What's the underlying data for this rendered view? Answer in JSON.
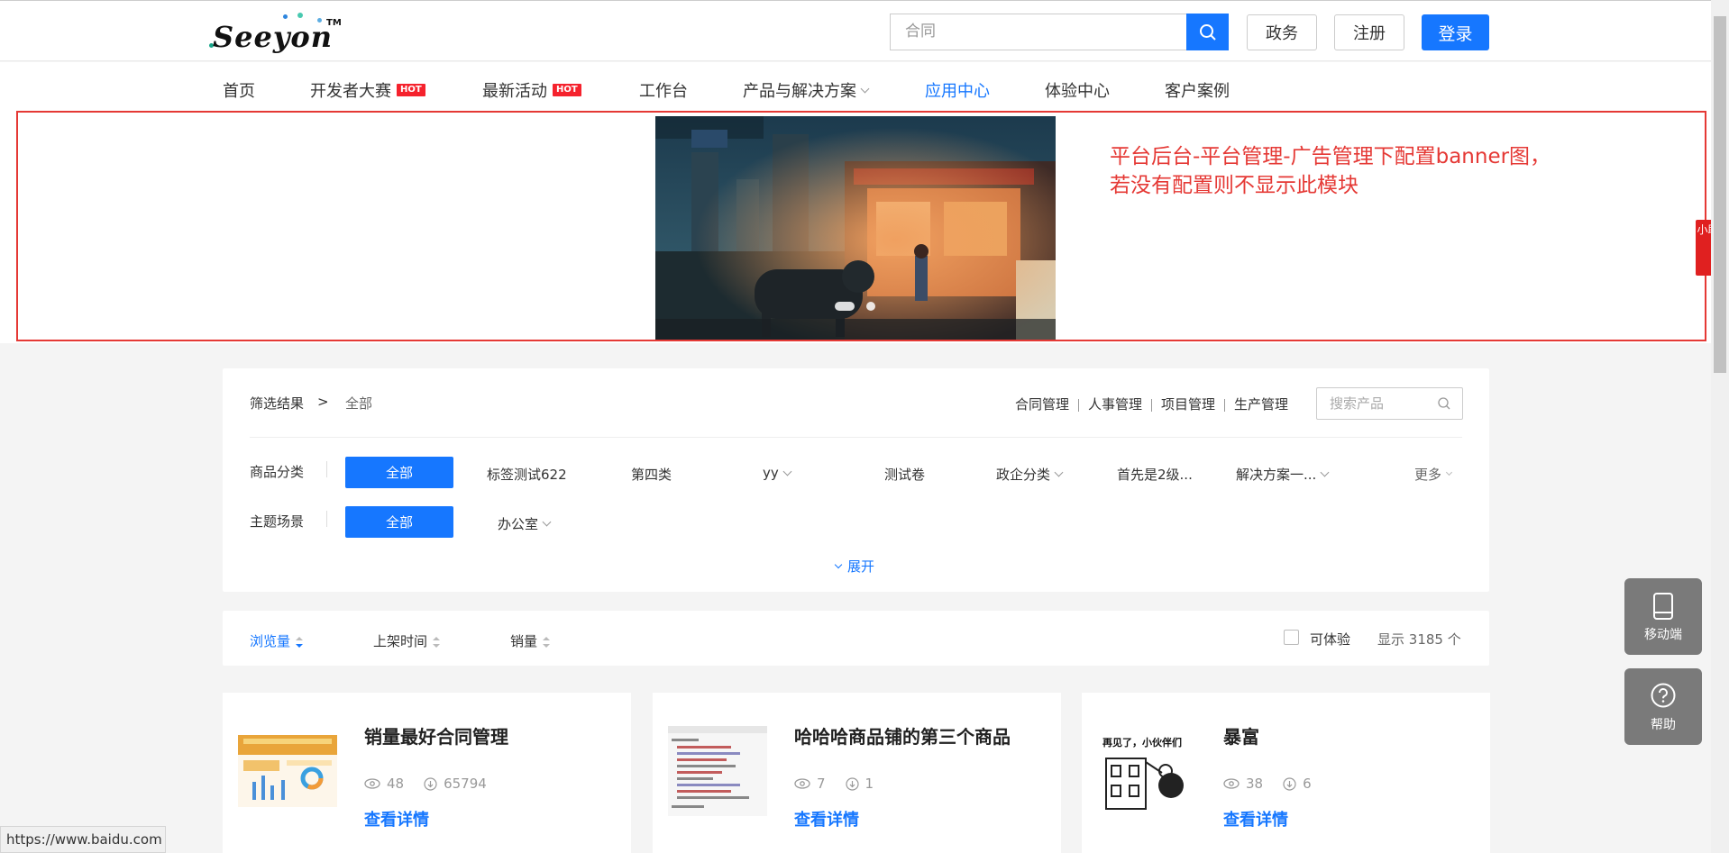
{
  "header": {
    "logo_text": "Seeyon",
    "logo_tm": "TM",
    "search_value": "合同",
    "gov_label": "政务",
    "register_label": "注册",
    "login_label": "登录"
  },
  "nav": {
    "items": [
      {
        "label": "首页"
      },
      {
        "label": "开发者大赛",
        "badge": "HOT"
      },
      {
        "label": "最新活动",
        "badge": "HOT"
      },
      {
        "label": "工作台"
      },
      {
        "label": "产品与解决方案"
      },
      {
        "label": "应用中心",
        "active": true
      },
      {
        "label": "体验中心"
      },
      {
        "label": "客户案例"
      }
    ]
  },
  "banner": {
    "note_line1": "平台后台-平台管理-广告管理下配置banner图，",
    "note_line2": "若没有配置则不显示此模块",
    "side_tag": "小助"
  },
  "filter": {
    "result_label": "筛选结果",
    "arrow": ">",
    "current": "全部",
    "quick_tags": [
      "合同管理",
      "人事管理",
      "项目管理",
      "生产管理"
    ],
    "search_placeholder": "搜索产品",
    "category_label": "商品分类",
    "category_all": "全部",
    "categories": [
      "标签测试622",
      "第四类",
      "yy",
      "测试卷",
      "政企分类",
      "首先是2级...",
      "解决方案一...",
      "更多"
    ],
    "scene_label": "主题场景",
    "scene_all": "全部",
    "scenes": [
      "办公室"
    ],
    "expand_label": "展开"
  },
  "sort": {
    "views": "浏览量",
    "listing_time": "上架时间",
    "sales": "销量",
    "tryout": "可体验",
    "count_prefix": "显示",
    "count": "3185",
    "count_unit": "个"
  },
  "products": [
    {
      "title": "销量最好合同管理",
      "views": "48",
      "downloads": "65794",
      "link": "查看详情"
    },
    {
      "title": "哈哈哈商品铺的第三个商品",
      "views": "7",
      "downloads": "1",
      "link": "查看详情"
    },
    {
      "title": "暴富",
      "views": "38",
      "downloads": "6",
      "link": "查看详情",
      "thumb_text": "再见了，小伙伴们"
    }
  ],
  "float": {
    "mobile": "移动端",
    "help": "帮助"
  },
  "status_url": "https://www.baidu.com",
  "colors": {
    "primary": "#1677ff",
    "hot": "#f5222d",
    "note": "#e53935"
  }
}
